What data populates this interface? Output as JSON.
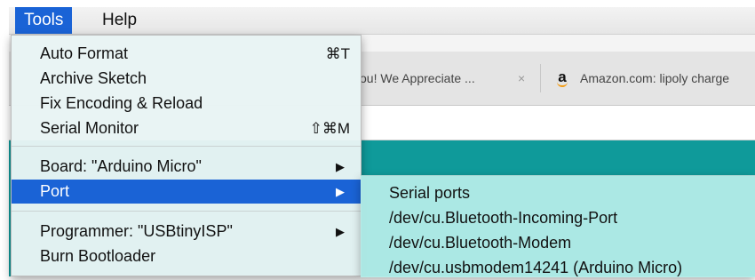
{
  "menubar": {
    "items": [
      {
        "label": "Tools",
        "active": true
      },
      {
        "label": "Help",
        "active": false
      }
    ]
  },
  "browser": {
    "tabs": [
      {
        "title": "ou! We Appreciate ...",
        "close": "×"
      },
      {
        "title": "Amazon.com: lipoly charge",
        "icon": "amazon-icon",
        "icon_glyph": "a"
      }
    ]
  },
  "tools_menu": {
    "groups": [
      [
        {
          "label": "Auto Format",
          "shortcut": "⌘T"
        },
        {
          "label": "Archive Sketch",
          "shortcut": ""
        },
        {
          "label": "Fix Encoding & Reload",
          "shortcut": ""
        },
        {
          "label": "Serial Monitor",
          "shortcut": "⇧⌘M"
        }
      ],
      [
        {
          "label": "Board: \"Arduino Micro\"",
          "submenu_arrow": "▶"
        },
        {
          "label": "Port",
          "submenu_arrow": "▶",
          "highlighted": true
        }
      ],
      [
        {
          "label": "Programmer: \"USBtinyISP\"",
          "submenu_arrow": "▶"
        },
        {
          "label": "Burn Bootloader",
          "shortcut": ""
        }
      ]
    ]
  },
  "port_submenu": {
    "heading": "Serial ports",
    "items": [
      "/dev/cu.Bluetooth-Incoming-Port",
      "/dev/cu.Bluetooth-Modem",
      "/dev/cu.usbmodem14241 (Arduino Micro)"
    ]
  },
  "colors": {
    "highlight": "#1a63d6",
    "ide_teal": "#0f9a9a",
    "submenu_bg": "#b4ece8"
  }
}
